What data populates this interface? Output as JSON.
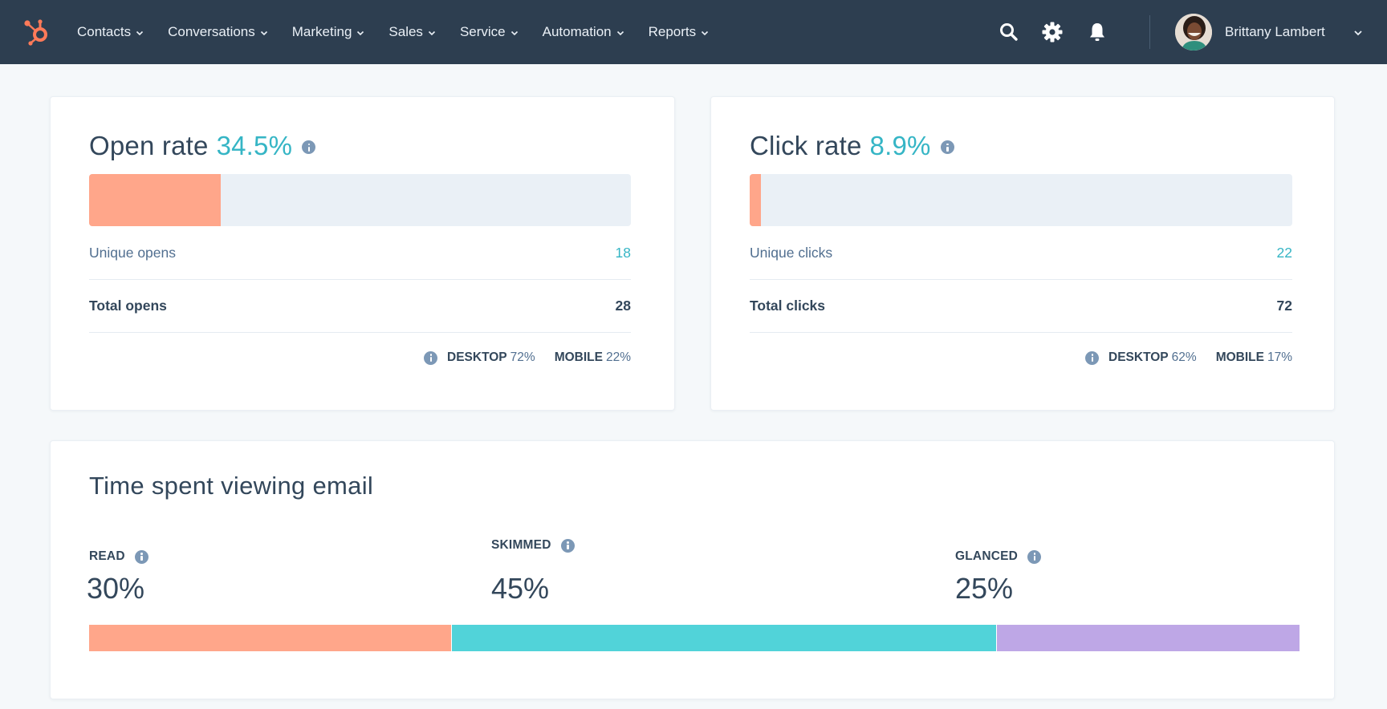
{
  "nav": {
    "logo": "hubspot-sprocket-logo",
    "items": [
      {
        "label": "Contacts"
      },
      {
        "label": "Conversations"
      },
      {
        "label": "Marketing"
      },
      {
        "label": "Sales"
      },
      {
        "label": "Service"
      },
      {
        "label": "Automation"
      },
      {
        "label": "Reports"
      }
    ],
    "icons": [
      "search-icon",
      "gear-icon",
      "bell-icon"
    ],
    "user": {
      "name": "Brittany Lambert"
    }
  },
  "colors": {
    "nav_bg": "#2d3e50",
    "brand_orange": "#ff7a59",
    "accent_teal": "#35b5c5",
    "bar_orange": "#ffa68a",
    "bar_teal": "#51d3d9",
    "bar_purple": "#bea7e6",
    "track": "#eaf0f6"
  },
  "open_rate": {
    "title": "Open rate",
    "value": "34.5%",
    "bar_fill_fraction": 0.243,
    "unique_label": "Unique opens",
    "unique_value": "18",
    "total_label": "Total opens",
    "total_value": "28",
    "desktop_label": "DESKTOP",
    "desktop_value": "72%",
    "mobile_label": "MOBILE",
    "mobile_value": "22%"
  },
  "click_rate": {
    "title": "Click rate",
    "value": "8.9%",
    "bar_fill_fraction": 0.02,
    "unique_label": "Unique clicks",
    "unique_value": "22",
    "total_label": "Total clicks",
    "total_value": "72",
    "desktop_label": "DESKTOP",
    "desktop_value": "62%",
    "mobile_label": "MOBILE",
    "mobile_value": "17%"
  },
  "time_spent": {
    "title": "Time spent viewing email",
    "segments": [
      {
        "label": "READ",
        "value": "30%",
        "fraction": 0.3,
        "color": "#ffa68a"
      },
      {
        "label": "SKIMMED",
        "value": "45%",
        "fraction": 0.45,
        "color": "#51d3d9"
      },
      {
        "label": "GLANCED",
        "value": "25%",
        "fraction": 0.25,
        "color": "#bea7e6"
      }
    ]
  }
}
